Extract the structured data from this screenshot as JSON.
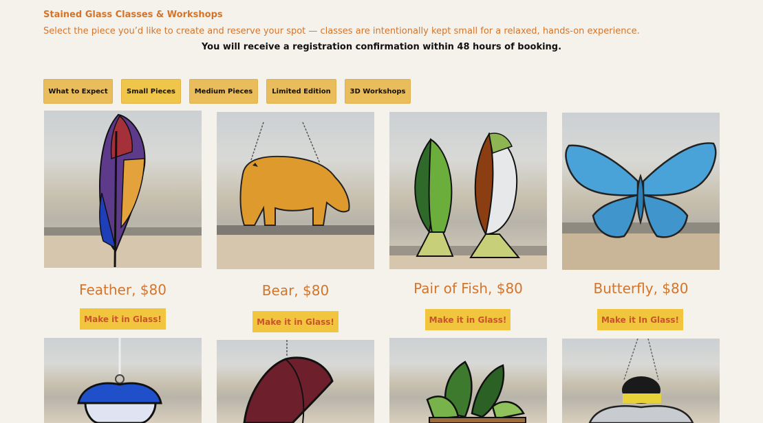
{
  "header": {
    "title": "Stained Glass Classes & Workshops",
    "subtitle": "Select the piece you’d like to create and reserve your spot — classes are intentionally kept small for a relaxed, hands-on experience.",
    "notice": "You will receive a registration confirmation within 48 hours of booking."
  },
  "tabs": [
    {
      "label": "What to Expect"
    },
    {
      "label": "Small Pieces",
      "active": true
    },
    {
      "label": "Medium Pieces"
    },
    {
      "label": "Limited Edition"
    },
    {
      "label": "3D Workshops"
    }
  ],
  "products": [
    {
      "name": "Feather, $80",
      "button": "Make it in Glass!",
      "icon": "feather-glass"
    },
    {
      "name": "Bear, $80",
      "button": "Make it in Glass!",
      "icon": "bear-glass"
    },
    {
      "name": "Pair of Fish, $80",
      "button": "Make it in Glass!",
      "icon": "fish-glass"
    },
    {
      "name": "Butterfly, $80",
      "button": "Make it In Glass!",
      "icon": "butterfly-glass"
    }
  ],
  "second_row": [
    {
      "icon": "pansy-glass"
    },
    {
      "icon": "leaf-glass"
    },
    {
      "icon": "succulent-glass"
    },
    {
      "icon": "bee-glass"
    }
  ],
  "colors": {
    "accent": "#d4742a",
    "tab_bg": "#e9bc5c",
    "button_bg": "#f2c53f",
    "page_bg": "#f5f2ec"
  }
}
